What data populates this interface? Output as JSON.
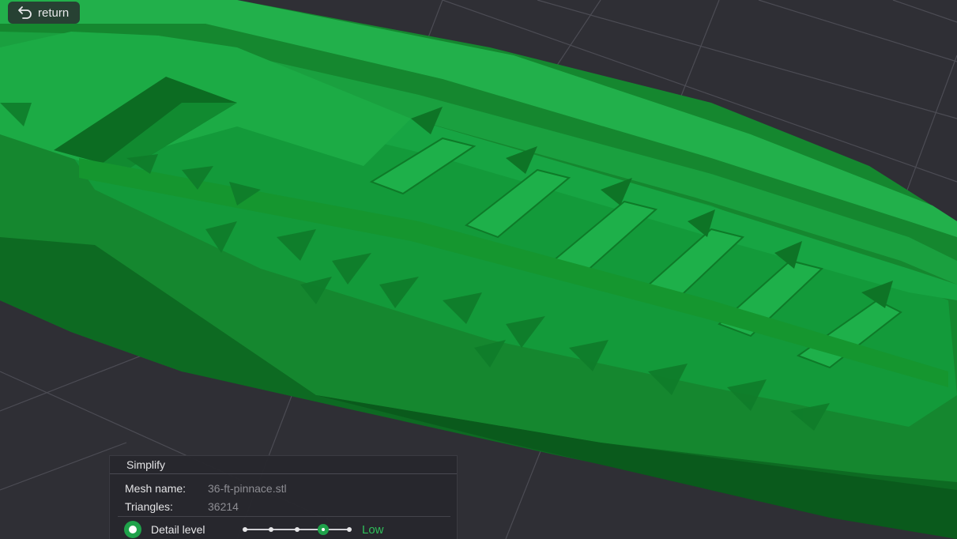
{
  "toolbar": {
    "return_label": "return",
    "return_icon": "undo-arrow-icon"
  },
  "viewport": {
    "background_color": "#2f2f35",
    "grid_color": "#4a4a52",
    "model_color": "#1fa24a"
  },
  "simplify": {
    "title": "Simplify",
    "mesh_name_label": "Mesh name:",
    "mesh_name_value": "36-ft-pinnace.stl",
    "triangles_label": "Triangles:",
    "triangles_value": "36214",
    "detail_level_label": "Detail level",
    "detail_level_value": "Low",
    "detail_level_steps": 5,
    "detail_level_selected_step": 4,
    "accent_color": "#1fa24a"
  }
}
